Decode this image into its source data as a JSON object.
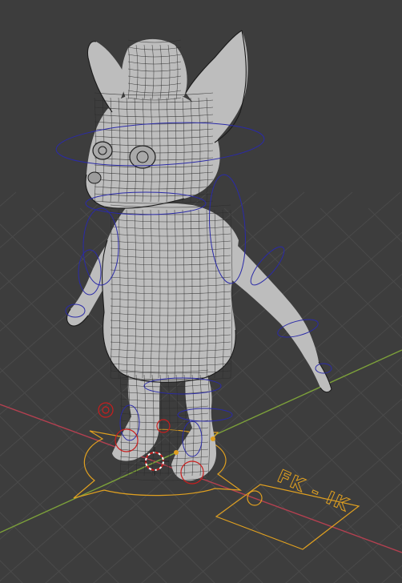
{
  "viewport": {
    "label_fkik": "FK - IK"
  },
  "colors": {
    "background": "#3d3d3d",
    "grid": "#4a4a4a",
    "axis_x": "#b34050",
    "axis_y": "#7ca03a",
    "mesh": "#bdbdbd",
    "control_blue": "#2a2aa8",
    "control_orange": "#e0a020",
    "control_red": "#c81e1e"
  },
  "icons": {
    "cursor": "3d-cursor-icon"
  }
}
